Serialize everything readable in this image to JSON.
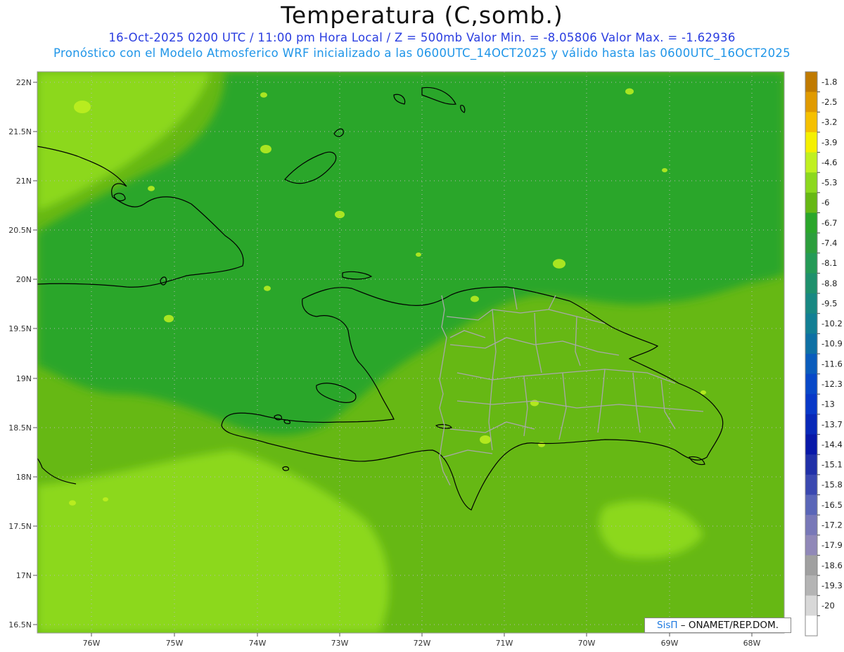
{
  "title": "Temperatura (C,somb.)",
  "subtitle_line1": "16-Oct-2025  0200 UTC / 11:00 pm Hora Local / Z = 500mb  Valor Min. = -8.05806  Valor Max. = -1.62936",
  "subtitle_line2": "Pronóstico con el Modelo Atmosferico WRF inicializado a las 0600UTC_14OCT2025 y válido hasta las  0600UTC_16OCT2025",
  "credit": {
    "sis": "SisΠ",
    "rest": " – ONAMET/REP.DOM."
  },
  "lat_labels": [
    "22N",
    "21.5N",
    "21N",
    "20.5N",
    "20N",
    "19.5N",
    "19N",
    "18.5N",
    "18N",
    "17.5N",
    "17N",
    "16.5N"
  ],
  "lon_labels": [
    "76W",
    "75W",
    "74W",
    "73W",
    "72W",
    "71W",
    "70W",
    "69W",
    "68W"
  ],
  "colorbar": {
    "labels": [
      "-1.8",
      "-2.5",
      "-3.2",
      "-3.9",
      "-4.6",
      "-5.3",
      "-6",
      "-6.7",
      "-7.4",
      "-8.1",
      "-8.8",
      "-9.5",
      "-10.2",
      "-10.9",
      "-11.6",
      "-12.3",
      "-13",
      "-13.7",
      "-14.4",
      "-15.1",
      "-15.8",
      "-16.5",
      "-17.2",
      "-17.9",
      "-18.6",
      "-19.3",
      "-20"
    ],
    "colors": [
      "#c07a00",
      "#e09a00",
      "#f5c000",
      "#f5f000",
      "#c0f020",
      "#8cd81e",
      "#66b814",
      "#2aa62a",
      "#2c9e3c",
      "#249a56",
      "#1e906c",
      "#188882",
      "#127f94",
      "#0e70a4",
      "#0a5cbc",
      "#0848c8",
      "#0838c8",
      "#0828b8",
      "#0818a8",
      "#2030a8",
      "#3a48b0",
      "#5a66b8",
      "#7878b8",
      "#9088b8",
      "#a0a0a0",
      "#b4b4b4",
      "#d8d8d8",
      "#ffffff"
    ]
  },
  "colors": {
    "ocean_base": "#66b814",
    "ocean_north": "#2aa62a",
    "ocean_south": "#8cd81e",
    "coast": "#000000",
    "border": "#a8a8a8"
  }
}
